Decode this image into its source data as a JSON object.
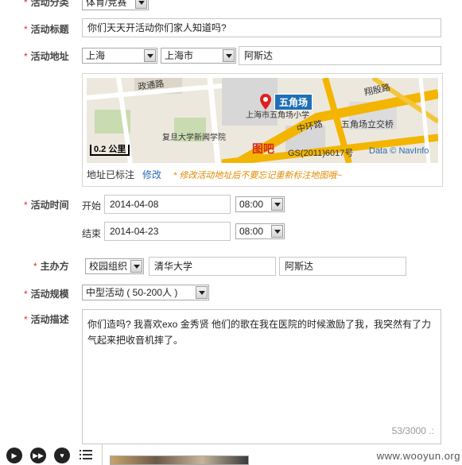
{
  "category": {
    "label": "活动分类",
    "value": "体育/竞赛"
  },
  "title": {
    "label": "活动标题",
    "value": "你们天天开活动你们家人知道吗?"
  },
  "location": {
    "label": "活动地址",
    "province": "上海",
    "city": "上海市",
    "detail": "阿斯达",
    "map": {
      "roads": [
        "政通路",
        "翔殷路",
        "中环路",
        "五角场立交桥"
      ],
      "places": [
        "五角场",
        "上海市五角场小学",
        "复旦大学新闻学院"
      ],
      "scale": "0.2 公里",
      "logo": "图吧",
      "license": "GS(2011)6017号",
      "credit": "Data © NavInfo"
    },
    "marked_text": "地址已标注",
    "edit_link": "修改",
    "hint": "* 修改活动地址后不要忘记重新标注地图哦~"
  },
  "time": {
    "label": "活动时间",
    "start_label": "开始",
    "start_date": "2014-04-08",
    "start_time": "08:00",
    "end_label": "结束",
    "end_date": "2014-04-23",
    "end_time": "08:00"
  },
  "organizer": {
    "label": "主办方",
    "type": "校园组织",
    "name": "清华大学",
    "extra": "阿斯达"
  },
  "scale": {
    "label": "活动规模",
    "value": "中型活动 ( 50-200人 )"
  },
  "description": {
    "label": "活动描述",
    "text": "你们造吗? 我喜欢exo 金秀贤  他们的歌在我在医院的时候激励了我，我突然有了力气起来把收音机摔了。",
    "counter": "53/3000"
  },
  "watermark": "www.wooyun.org",
  "colors": {
    "required_star": "#e03030",
    "link": "#2a6db4",
    "hint": "#e08a00"
  }
}
